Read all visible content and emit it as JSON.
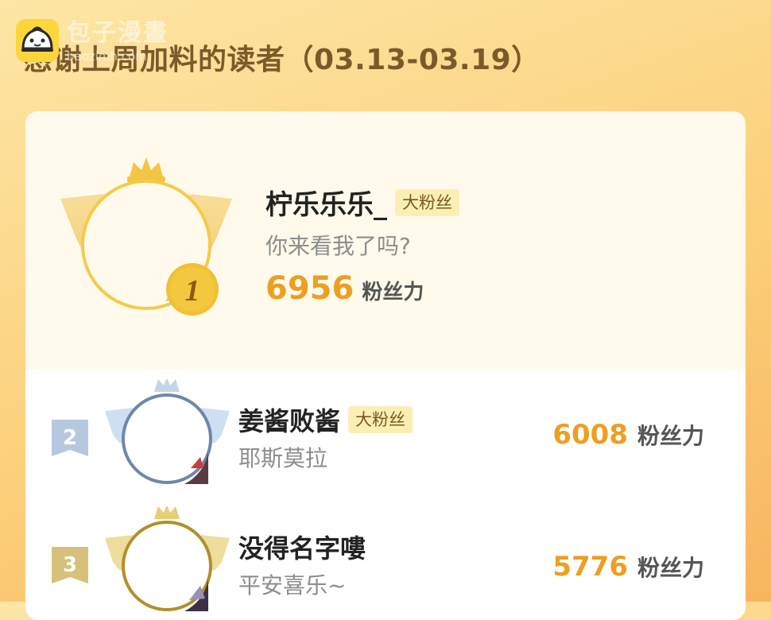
{
  "watermark": {
    "site_name": "包子漫畫",
    "url": "baozimh.com"
  },
  "page": {
    "title": "感谢上周加料的读者（03.13-03.19）"
  },
  "leaderboard": {
    "first": {
      "rank": "1",
      "name": "柠乐乐乐_",
      "badge": "大粉丝",
      "message": "你来看我了吗?",
      "score": "6956",
      "score_unit": "粉丝力"
    },
    "rows": [
      {
        "rank": "2",
        "name": "姜酱败酱",
        "badge": "大粉丝",
        "message": "耶斯莫拉",
        "score": "6008",
        "score_unit": "粉丝力"
      },
      {
        "rank": "3",
        "name": "没得名字嘍",
        "badge": "",
        "message": "平安喜乐~",
        "score": "5776",
        "score_unit": "粉丝力"
      }
    ]
  },
  "colors": {
    "accent": "#ed9f22",
    "gold": "#f2cb4a",
    "silver": "#9fb3cf",
    "bronze": "#c5a040",
    "badge_bg": "#fcefb4"
  },
  "icons": [
    "baozi-logo-icon",
    "gold-crown-medal-icon",
    "silver-crown-medal-icon",
    "bronze-crown-medal-icon",
    "rank-ribbon-icon"
  ]
}
